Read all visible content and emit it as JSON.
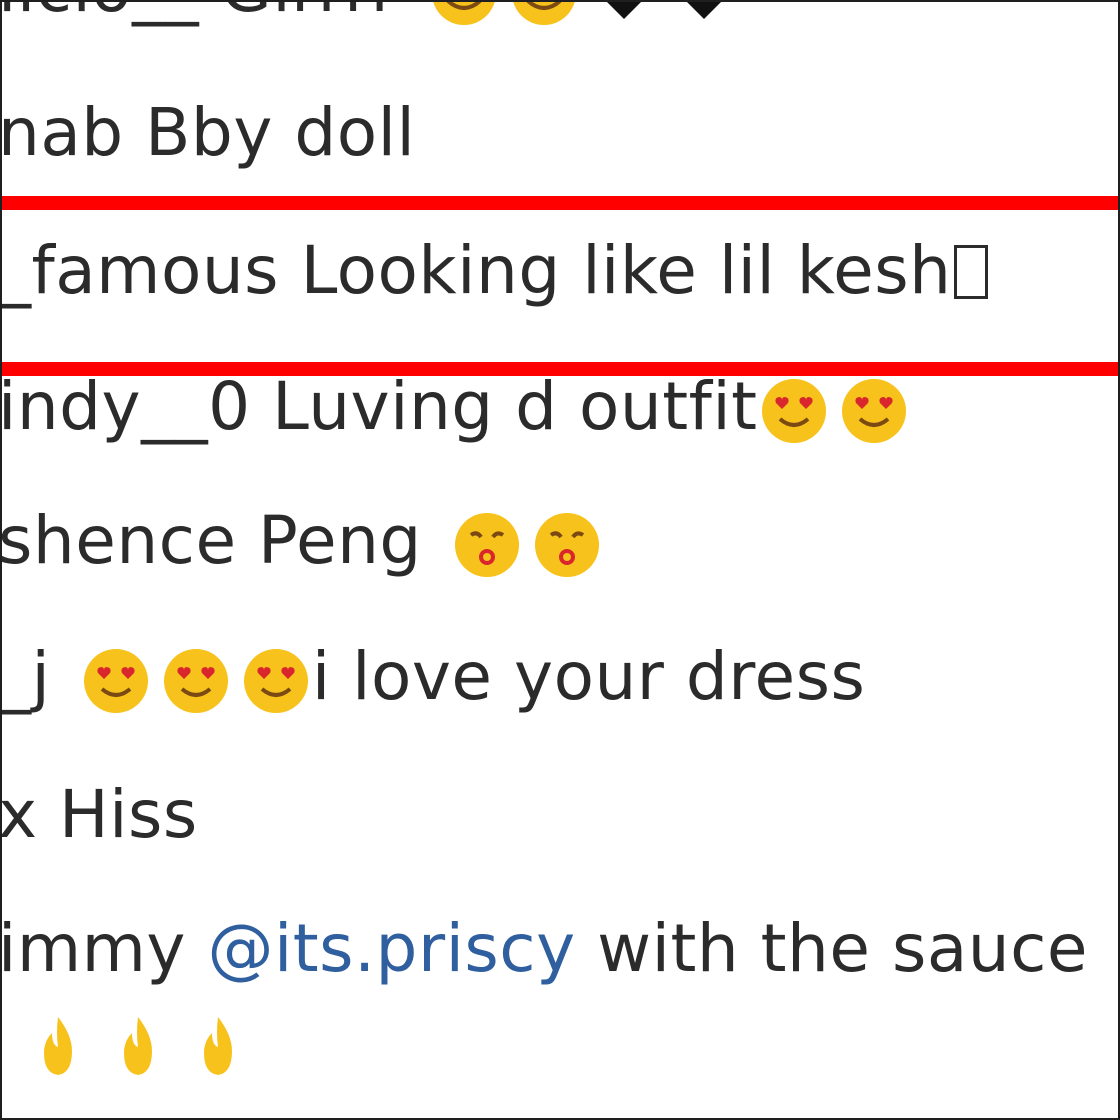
{
  "comments": [
    {
      "user": "iicio__",
      "text": "Girrrr"
    },
    {
      "user": "nab",
      "text": "Bby doll"
    },
    {
      "user": "_famous",
      "text": "Looking like lil kesh"
    },
    {
      "user": "indy__0",
      "text": "Luving d outfit"
    },
    {
      "user": "shence",
      "text": "Peng"
    },
    {
      "user": "_j",
      "text": "i love your dress"
    },
    {
      "user": "x",
      "text": "Hiss"
    },
    {
      "user": "immy",
      "mention": "@its.priscy",
      "text": "with the sauce"
    }
  ],
  "annotation": {
    "color": "#ff0000"
  },
  "icons": {
    "heart_eyes": "heart-eyes-face-icon",
    "kiss": "kissing-face-icon",
    "fire": "fire-icon",
    "black_heart": "black-heart-icon",
    "missing_glyph": "missing-glyph-icon"
  }
}
